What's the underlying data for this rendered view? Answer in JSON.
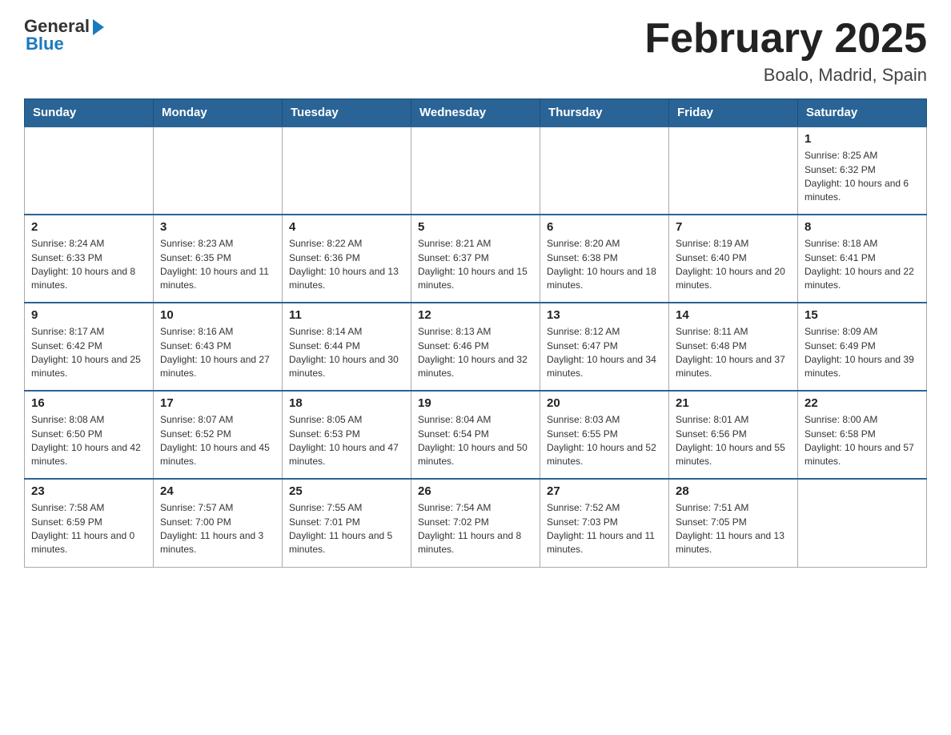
{
  "logo": {
    "general": "General",
    "blue": "Blue"
  },
  "header": {
    "title": "February 2025",
    "location": "Boalo, Madrid, Spain"
  },
  "weekdays": [
    "Sunday",
    "Monday",
    "Tuesday",
    "Wednesday",
    "Thursday",
    "Friday",
    "Saturday"
  ],
  "weeks": [
    [
      {
        "day": "",
        "info": ""
      },
      {
        "day": "",
        "info": ""
      },
      {
        "day": "",
        "info": ""
      },
      {
        "day": "",
        "info": ""
      },
      {
        "day": "",
        "info": ""
      },
      {
        "day": "",
        "info": ""
      },
      {
        "day": "1",
        "info": "Sunrise: 8:25 AM\nSunset: 6:32 PM\nDaylight: 10 hours and 6 minutes."
      }
    ],
    [
      {
        "day": "2",
        "info": "Sunrise: 8:24 AM\nSunset: 6:33 PM\nDaylight: 10 hours and 8 minutes."
      },
      {
        "day": "3",
        "info": "Sunrise: 8:23 AM\nSunset: 6:35 PM\nDaylight: 10 hours and 11 minutes."
      },
      {
        "day": "4",
        "info": "Sunrise: 8:22 AM\nSunset: 6:36 PM\nDaylight: 10 hours and 13 minutes."
      },
      {
        "day": "5",
        "info": "Sunrise: 8:21 AM\nSunset: 6:37 PM\nDaylight: 10 hours and 15 minutes."
      },
      {
        "day": "6",
        "info": "Sunrise: 8:20 AM\nSunset: 6:38 PM\nDaylight: 10 hours and 18 minutes."
      },
      {
        "day": "7",
        "info": "Sunrise: 8:19 AM\nSunset: 6:40 PM\nDaylight: 10 hours and 20 minutes."
      },
      {
        "day": "8",
        "info": "Sunrise: 8:18 AM\nSunset: 6:41 PM\nDaylight: 10 hours and 22 minutes."
      }
    ],
    [
      {
        "day": "9",
        "info": "Sunrise: 8:17 AM\nSunset: 6:42 PM\nDaylight: 10 hours and 25 minutes."
      },
      {
        "day": "10",
        "info": "Sunrise: 8:16 AM\nSunset: 6:43 PM\nDaylight: 10 hours and 27 minutes."
      },
      {
        "day": "11",
        "info": "Sunrise: 8:14 AM\nSunset: 6:44 PM\nDaylight: 10 hours and 30 minutes."
      },
      {
        "day": "12",
        "info": "Sunrise: 8:13 AM\nSunset: 6:46 PM\nDaylight: 10 hours and 32 minutes."
      },
      {
        "day": "13",
        "info": "Sunrise: 8:12 AM\nSunset: 6:47 PM\nDaylight: 10 hours and 34 minutes."
      },
      {
        "day": "14",
        "info": "Sunrise: 8:11 AM\nSunset: 6:48 PM\nDaylight: 10 hours and 37 minutes."
      },
      {
        "day": "15",
        "info": "Sunrise: 8:09 AM\nSunset: 6:49 PM\nDaylight: 10 hours and 39 minutes."
      }
    ],
    [
      {
        "day": "16",
        "info": "Sunrise: 8:08 AM\nSunset: 6:50 PM\nDaylight: 10 hours and 42 minutes."
      },
      {
        "day": "17",
        "info": "Sunrise: 8:07 AM\nSunset: 6:52 PM\nDaylight: 10 hours and 45 minutes."
      },
      {
        "day": "18",
        "info": "Sunrise: 8:05 AM\nSunset: 6:53 PM\nDaylight: 10 hours and 47 minutes."
      },
      {
        "day": "19",
        "info": "Sunrise: 8:04 AM\nSunset: 6:54 PM\nDaylight: 10 hours and 50 minutes."
      },
      {
        "day": "20",
        "info": "Sunrise: 8:03 AM\nSunset: 6:55 PM\nDaylight: 10 hours and 52 minutes."
      },
      {
        "day": "21",
        "info": "Sunrise: 8:01 AM\nSunset: 6:56 PM\nDaylight: 10 hours and 55 minutes."
      },
      {
        "day": "22",
        "info": "Sunrise: 8:00 AM\nSunset: 6:58 PM\nDaylight: 10 hours and 57 minutes."
      }
    ],
    [
      {
        "day": "23",
        "info": "Sunrise: 7:58 AM\nSunset: 6:59 PM\nDaylight: 11 hours and 0 minutes."
      },
      {
        "day": "24",
        "info": "Sunrise: 7:57 AM\nSunset: 7:00 PM\nDaylight: 11 hours and 3 minutes."
      },
      {
        "day": "25",
        "info": "Sunrise: 7:55 AM\nSunset: 7:01 PM\nDaylight: 11 hours and 5 minutes."
      },
      {
        "day": "26",
        "info": "Sunrise: 7:54 AM\nSunset: 7:02 PM\nDaylight: 11 hours and 8 minutes."
      },
      {
        "day": "27",
        "info": "Sunrise: 7:52 AM\nSunset: 7:03 PM\nDaylight: 11 hours and 11 minutes."
      },
      {
        "day": "28",
        "info": "Sunrise: 7:51 AM\nSunset: 7:05 PM\nDaylight: 11 hours and 13 minutes."
      },
      {
        "day": "",
        "info": ""
      }
    ]
  ]
}
